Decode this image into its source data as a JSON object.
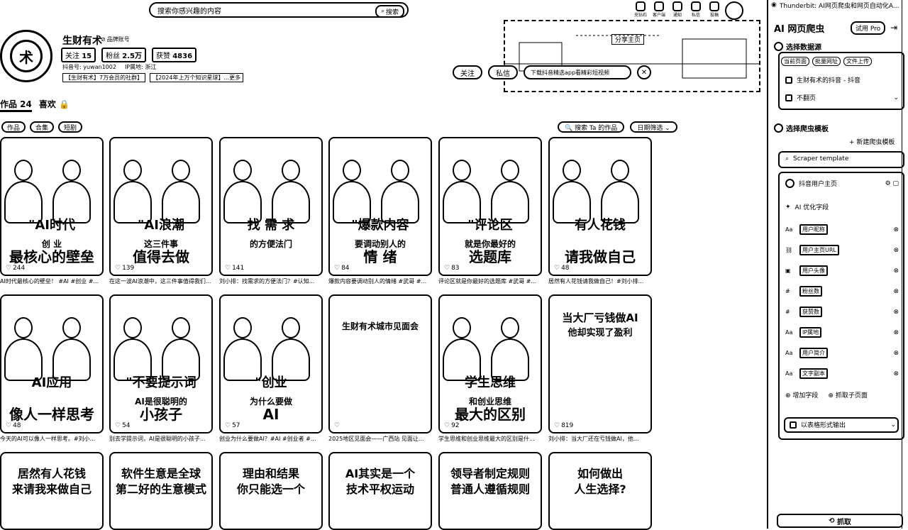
{
  "search": {
    "placeholder": "搜索你感兴趣的内容",
    "button": "搜索"
  },
  "topbar": {
    "icons": [
      {
        "name": "subscribe-icon",
        "label": "充钻石"
      },
      {
        "name": "client-icon",
        "label": "客户端"
      },
      {
        "name": "dm-icon",
        "label": "通知"
      },
      {
        "name": "post-icon",
        "label": "私信"
      },
      {
        "name": "upload-icon",
        "label": "投稿"
      }
    ]
  },
  "profile": {
    "name": "生财有术",
    "badge": "品牌账号",
    "logo_text": "术",
    "stats": [
      {
        "label": "关注",
        "value": "15"
      },
      {
        "label": "粉丝",
        "value": "2.5万"
      },
      {
        "label": "获赞",
        "value": "4836"
      }
    ],
    "id_label": "抖音号:",
    "id_value": "yuwan1002",
    "ip_label": "IP属地:",
    "ip_value": "浙江",
    "tags": [
      "【生财有术】7万会员的社群】",
      "【2024年上万个知识星球】...更多"
    ]
  },
  "banner": {
    "home_label": "分享主页"
  },
  "actions": {
    "follow": "关注",
    "message": "私信",
    "notice": "下载抖音精选app看精彩短视频"
  },
  "tabs": [
    {
      "label": "作品 24",
      "active": true
    },
    {
      "label": "喜欢 🔒",
      "active": false
    }
  ],
  "filters": [
    "作品",
    "合集",
    "短剧"
  ],
  "right_filters": [
    "🔍 搜索 Ta 的作品",
    "日期筛选 ⌄"
  ],
  "cards": [
    {
      "t1": "\"AI时代",
      "t2": "创    业",
      "t3": "最核心的壁垒",
      "likes": "244",
      "desc": "AI时代最核心的壁垒！ #AI #创业 #..."
    },
    {
      "t1": "\"AI浪潮",
      "t2": "这三件事",
      "t3": "值得去做",
      "likes": "139",
      "desc": "在这一波AI浪潮中，这三件事值得我们..."
    },
    {
      "t1": "找 需 求",
      "t2": "的方便法门",
      "t3": "",
      "likes": "141",
      "desc": "刘小排：找需求的方便法门？#认知..."
    },
    {
      "t1": "\"爆款内容",
      "t2": "要调动别人的",
      "t3": "情  绪",
      "likes": "84",
      "desc": "爆款内容要调动别人的情绪 #武哥 #..."
    },
    {
      "t1": "\"评论区",
      "t2": "就是你最好的",
      "t3": "选题库",
      "likes": "83",
      "desc": "评论区就是你最好的选题库 #武哥 #..."
    },
    {
      "t1": "有人花钱",
      "t2": "",
      "t3": "请我做自己",
      "likes": "48",
      "desc": "居然有人花钱请我做自己！#刘小排..."
    },
    {
      "t1": "AI应用",
      "t2": "",
      "t3": "像人一样思考",
      "likes": "48",
      "desc": "今天的AI可以像人一样思考。#刘小..."
    },
    {
      "t1": "\"不要提示词",
      "t2": "AI是很聪明的",
      "t3": "小孩子",
      "likes": "54",
      "desc": "别去学提示词，AI是很聪明的小孩子..."
    },
    {
      "t1": "\"创业",
      "t2": "为什么要做",
      "t3": "AI",
      "likes": "57",
      "desc": "创业为什么要做AI？#AI #创业者 #..."
    },
    {
      "t1": "生财有术城市见面会",
      "t2": "",
      "t3": "",
      "likes": "",
      "desc": "2025地区见面会——广西站 见面让..."
    },
    {
      "t1": "学生思维",
      "t2": "和创业思维",
      "t3": "最大的区别",
      "likes": "92",
      "desc": "学生思维和创业思维最大的区别是什..."
    },
    {
      "t1": "当大厂亏钱做AI",
      "t2": "他却实现了盈利",
      "t3": "",
      "likes": "819",
      "desc": "刘小排：当大厂还在亏钱做AI，他..."
    },
    {
      "t1": "居然有人花钱",
      "t2": "来请我来做自己",
      "t3": "",
      "likes": "",
      "desc": ""
    },
    {
      "t1": "软件生意是全球",
      "t2": "第二好的生意模式",
      "t3": "",
      "likes": "",
      "desc": ""
    },
    {
      "t1": "理由和结果",
      "t2": "你只能选一个",
      "t3": "",
      "likes": "",
      "desc": ""
    },
    {
      "t1": "AI其实是一个",
      "t2": "技术平权运动",
      "t3": "",
      "likes": "",
      "desc": ""
    },
    {
      "t1": "领导者制定规则",
      "t2": "普通人遵循规则",
      "t3": "",
      "likes": "",
      "desc": ""
    },
    {
      "t1": "如何做出",
      "t2": "人生选择?",
      "t3": "",
      "likes": "",
      "desc": ""
    }
  ],
  "panel": {
    "tab_label": "Thunderbit: AI网页爬虫和网页自动化A...",
    "title": "AI 网页爬虫",
    "pro": "试用 Pro",
    "section1": "选择数据源",
    "source_modes": [
      "当前页面",
      "批量网址",
      "文件上传"
    ],
    "source_row1": "生财有术的抖音 - 抖音",
    "source_row2": "不翻页",
    "section2": "选择爬虫模板",
    "new_template": "+ 新建爬虫模板",
    "template_search": "Scraper template",
    "template_name": "抖音用户主页",
    "ai_optimize": "AI 优化字段",
    "fields": [
      {
        "icon": "text-icon",
        "label": "用户昵称"
      },
      {
        "icon": "link-icon",
        "label": "用户主页URL"
      },
      {
        "icon": "image-icon",
        "label": "用户头像"
      },
      {
        "icon": "number-icon",
        "label": "粉丝数"
      },
      {
        "icon": "number-icon",
        "label": "获赞数"
      },
      {
        "icon": "text-icon",
        "label": "IP属地"
      },
      {
        "icon": "text-icon",
        "label": "用户简介"
      },
      {
        "icon": "text-icon",
        "label": "文字副本"
      }
    ],
    "add_field": "增加字段",
    "subpage": "抓取子页面",
    "output": "以表格形式输出",
    "confirm": "抓取"
  }
}
